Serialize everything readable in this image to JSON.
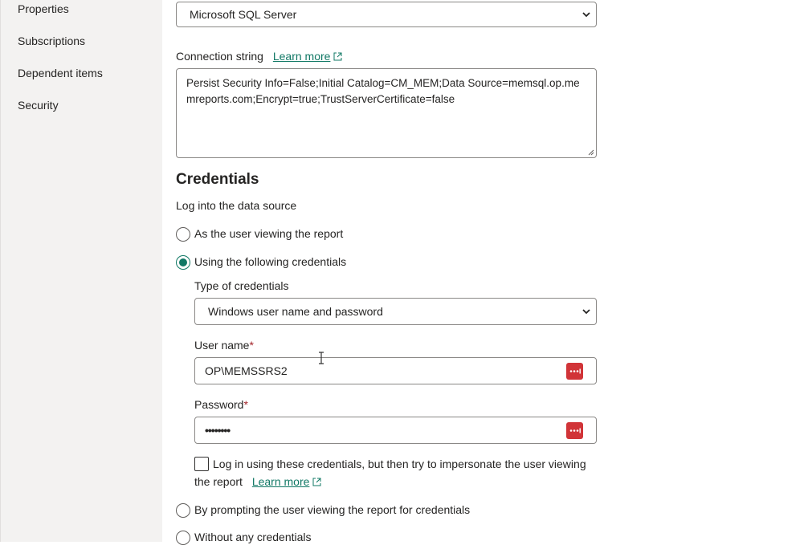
{
  "sidebar": {
    "items": [
      {
        "label": "Properties"
      },
      {
        "label": "Subscriptions"
      },
      {
        "label": "Dependent items"
      },
      {
        "label": "Security"
      }
    ]
  },
  "data_source_type": {
    "value": "Microsoft SQL Server"
  },
  "connection_string": {
    "label": "Connection string",
    "learn_more": "Learn more",
    "value": "Persist Security Info=False;Initial Catalog=CM_MEM;Data Source=memsql.op.memreports.com;Encrypt=true;TrustServerCertificate=false"
  },
  "credentials": {
    "heading": "Credentials",
    "subheading": "Log into the data source",
    "options": [
      {
        "label": "As the user viewing the report",
        "checked": false
      },
      {
        "label": "Using the following credentials",
        "checked": true
      },
      {
        "label": "By prompting the user viewing the report for credentials",
        "checked": false
      },
      {
        "label": "Without any credentials",
        "checked": false
      }
    ],
    "type_label": "Type of credentials",
    "type_value": "Windows user name and password",
    "username_label": "User name",
    "username_value": "OP\\MEMSSRS2",
    "password_label": "Password",
    "password_value": "••••••••",
    "required_mark": "*",
    "impersonate_label_line1": "Log in using these credentials, but then try to impersonate the user viewing",
    "impersonate_label_line2": "the report",
    "impersonate_learn_more": "Learn more"
  },
  "colors": {
    "accent": "#117865",
    "keyvault": "#d13438"
  }
}
